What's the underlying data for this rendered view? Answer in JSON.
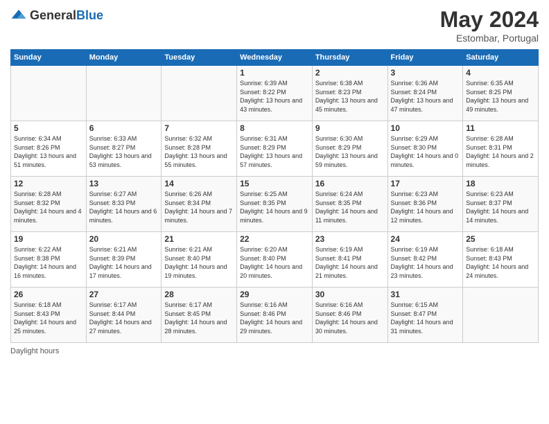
{
  "logo": {
    "general": "General",
    "blue": "Blue"
  },
  "header": {
    "month": "May 2024",
    "location": "Estombar, Portugal"
  },
  "weekdays": [
    "Sunday",
    "Monday",
    "Tuesday",
    "Wednesday",
    "Thursday",
    "Friday",
    "Saturday"
  ],
  "weeks": [
    [
      {
        "day": "",
        "sunrise": "",
        "sunset": "",
        "daylight": ""
      },
      {
        "day": "",
        "sunrise": "",
        "sunset": "",
        "daylight": ""
      },
      {
        "day": "",
        "sunrise": "",
        "sunset": "",
        "daylight": ""
      },
      {
        "day": "1",
        "sunrise": "Sunrise: 6:39 AM",
        "sunset": "Sunset: 8:22 PM",
        "daylight": "Daylight: 13 hours and 43 minutes."
      },
      {
        "day": "2",
        "sunrise": "Sunrise: 6:38 AM",
        "sunset": "Sunset: 8:23 PM",
        "daylight": "Daylight: 13 hours and 45 minutes."
      },
      {
        "day": "3",
        "sunrise": "Sunrise: 6:36 AM",
        "sunset": "Sunset: 8:24 PM",
        "daylight": "Daylight: 13 hours and 47 minutes."
      },
      {
        "day": "4",
        "sunrise": "Sunrise: 6:35 AM",
        "sunset": "Sunset: 8:25 PM",
        "daylight": "Daylight: 13 hours and 49 minutes."
      }
    ],
    [
      {
        "day": "5",
        "sunrise": "Sunrise: 6:34 AM",
        "sunset": "Sunset: 8:26 PM",
        "daylight": "Daylight: 13 hours and 51 minutes."
      },
      {
        "day": "6",
        "sunrise": "Sunrise: 6:33 AM",
        "sunset": "Sunset: 8:27 PM",
        "daylight": "Daylight: 13 hours and 53 minutes."
      },
      {
        "day": "7",
        "sunrise": "Sunrise: 6:32 AM",
        "sunset": "Sunset: 8:28 PM",
        "daylight": "Daylight: 13 hours and 55 minutes."
      },
      {
        "day": "8",
        "sunrise": "Sunrise: 6:31 AM",
        "sunset": "Sunset: 8:29 PM",
        "daylight": "Daylight: 13 hours and 57 minutes."
      },
      {
        "day": "9",
        "sunrise": "Sunrise: 6:30 AM",
        "sunset": "Sunset: 8:29 PM",
        "daylight": "Daylight: 13 hours and 59 minutes."
      },
      {
        "day": "10",
        "sunrise": "Sunrise: 6:29 AM",
        "sunset": "Sunset: 8:30 PM",
        "daylight": "Daylight: 14 hours and 0 minutes."
      },
      {
        "day": "11",
        "sunrise": "Sunrise: 6:28 AM",
        "sunset": "Sunset: 8:31 PM",
        "daylight": "Daylight: 14 hours and 2 minutes."
      }
    ],
    [
      {
        "day": "12",
        "sunrise": "Sunrise: 6:28 AM",
        "sunset": "Sunset: 8:32 PM",
        "daylight": "Daylight: 14 hours and 4 minutes."
      },
      {
        "day": "13",
        "sunrise": "Sunrise: 6:27 AM",
        "sunset": "Sunset: 8:33 PM",
        "daylight": "Daylight: 14 hours and 6 minutes."
      },
      {
        "day": "14",
        "sunrise": "Sunrise: 6:26 AM",
        "sunset": "Sunset: 8:34 PM",
        "daylight": "Daylight: 14 hours and 7 minutes."
      },
      {
        "day": "15",
        "sunrise": "Sunrise: 6:25 AM",
        "sunset": "Sunset: 8:35 PM",
        "daylight": "Daylight: 14 hours and 9 minutes."
      },
      {
        "day": "16",
        "sunrise": "Sunrise: 6:24 AM",
        "sunset": "Sunset: 8:35 PM",
        "daylight": "Daylight: 14 hours and 11 minutes."
      },
      {
        "day": "17",
        "sunrise": "Sunrise: 6:23 AM",
        "sunset": "Sunset: 8:36 PM",
        "daylight": "Daylight: 14 hours and 12 minutes."
      },
      {
        "day": "18",
        "sunrise": "Sunrise: 6:23 AM",
        "sunset": "Sunset: 8:37 PM",
        "daylight": "Daylight: 14 hours and 14 minutes."
      }
    ],
    [
      {
        "day": "19",
        "sunrise": "Sunrise: 6:22 AM",
        "sunset": "Sunset: 8:38 PM",
        "daylight": "Daylight: 14 hours and 16 minutes."
      },
      {
        "day": "20",
        "sunrise": "Sunrise: 6:21 AM",
        "sunset": "Sunset: 8:39 PM",
        "daylight": "Daylight: 14 hours and 17 minutes."
      },
      {
        "day": "21",
        "sunrise": "Sunrise: 6:21 AM",
        "sunset": "Sunset: 8:40 PM",
        "daylight": "Daylight: 14 hours and 19 minutes."
      },
      {
        "day": "22",
        "sunrise": "Sunrise: 6:20 AM",
        "sunset": "Sunset: 8:40 PM",
        "daylight": "Daylight: 14 hours and 20 minutes."
      },
      {
        "day": "23",
        "sunrise": "Sunrise: 6:19 AM",
        "sunset": "Sunset: 8:41 PM",
        "daylight": "Daylight: 14 hours and 21 minutes."
      },
      {
        "day": "24",
        "sunrise": "Sunrise: 6:19 AM",
        "sunset": "Sunset: 8:42 PM",
        "daylight": "Daylight: 14 hours and 23 minutes."
      },
      {
        "day": "25",
        "sunrise": "Sunrise: 6:18 AM",
        "sunset": "Sunset: 8:43 PM",
        "daylight": "Daylight: 14 hours and 24 minutes."
      }
    ],
    [
      {
        "day": "26",
        "sunrise": "Sunrise: 6:18 AM",
        "sunset": "Sunset: 8:43 PM",
        "daylight": "Daylight: 14 hours and 25 minutes."
      },
      {
        "day": "27",
        "sunrise": "Sunrise: 6:17 AM",
        "sunset": "Sunset: 8:44 PM",
        "daylight": "Daylight: 14 hours and 27 minutes."
      },
      {
        "day": "28",
        "sunrise": "Sunrise: 6:17 AM",
        "sunset": "Sunset: 8:45 PM",
        "daylight": "Daylight: 14 hours and 28 minutes."
      },
      {
        "day": "29",
        "sunrise": "Sunrise: 6:16 AM",
        "sunset": "Sunset: 8:46 PM",
        "daylight": "Daylight: 14 hours and 29 minutes."
      },
      {
        "day": "30",
        "sunrise": "Sunrise: 6:16 AM",
        "sunset": "Sunset: 8:46 PM",
        "daylight": "Daylight: 14 hours and 30 minutes."
      },
      {
        "day": "31",
        "sunrise": "Sunrise: 6:15 AM",
        "sunset": "Sunset: 8:47 PM",
        "daylight": "Daylight: 14 hours and 31 minutes."
      },
      {
        "day": "",
        "sunrise": "",
        "sunset": "",
        "daylight": ""
      }
    ]
  ],
  "footer": {
    "daylight_label": "Daylight hours"
  }
}
